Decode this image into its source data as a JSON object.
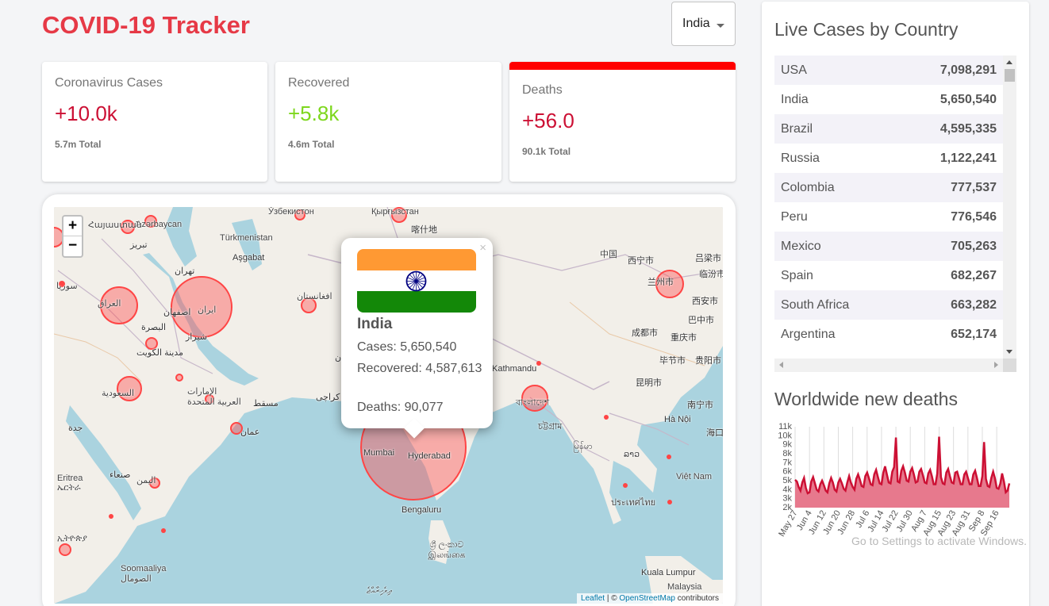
{
  "app": {
    "title": "COVID-19 Tracker"
  },
  "country_select": {
    "value": "India"
  },
  "stats": {
    "cases": {
      "label": "Coronavirus Cases",
      "value": "+10.0k",
      "total": "5.7m Total"
    },
    "recovered": {
      "label": "Recovered",
      "value": "+5.8k",
      "total": "4.6m Total"
    },
    "deaths": {
      "label": "Deaths",
      "value": "+56.0",
      "total": "90.1k Total"
    }
  },
  "colors": {
    "accent": "#e63946",
    "cases": "#cc1034",
    "recovered": "#7dd71d",
    "deaths_bar": "#ff0000",
    "circle": "#ff4545"
  },
  "map": {
    "zoom_in": "+",
    "zoom_out": "−",
    "attribution": {
      "leaflet": "Leaflet",
      "sep": " | © ",
      "osm": "OpenStreetMap",
      "suffix": " contributors"
    },
    "places": [
      "Türkmenistan",
      "Aşgabat",
      "Azərbaycan",
      "Հայաստան",
      "Ўзбекистон",
      "Қырғызстан",
      "喀什地",
      "中国",
      "西宁市",
      "兰州市",
      "吕梁市",
      "临汾市",
      "西安市",
      "巴中市",
      "成都市",
      "重庆市",
      "毕节市",
      "贵阳市",
      "昆明市",
      "南宁市",
      "Hà Nội",
      "海口",
      "Việt Nam",
      "ประเทศไทย",
      "ລາວ",
      "Malaysia",
      "Kuala Lumpur",
      "Mumbai",
      "Hyderabad",
      "Bengaluru",
      "ශ්‍රී ලංකාව இலங்கை",
      "ދިވެހިރާއްޖެ",
      "Soomaaliya الصومال",
      "Eritrea ኤርትራ",
      "ኢትዮጵያ",
      "اليمن",
      "صنعاء",
      "جدة",
      "مسقط",
      "عمان",
      "الإمارات العربية المتحدة",
      "السعودية",
      "العراق",
      "ایران",
      "اصفهان",
      "شیراز",
      "تهران",
      "تبريز",
      "مدينة الكويت",
      "البصرة",
      "افغانستان",
      "کراچی",
      "سوريا",
      "پاکستان",
      "Kathmandu",
      "বাংলাদেশ",
      "চট্টগ্রাম",
      "မြန်မာ"
    ],
    "popup": {
      "country": "India",
      "cases": "Cases: 5,650,540",
      "recovered": "Recovered: 4,587,613",
      "deaths": "Deaths: 90,077",
      "close": "×"
    }
  },
  "live_table": {
    "title": "Live Cases by Country",
    "rows": [
      {
        "country": "USA",
        "cases": "7,098,291"
      },
      {
        "country": "India",
        "cases": "5,650,540"
      },
      {
        "country": "Brazil",
        "cases": "4,595,335"
      },
      {
        "country": "Russia",
        "cases": "1,122,241"
      },
      {
        "country": "Colombia",
        "cases": "777,537"
      },
      {
        "country": "Peru",
        "cases": "776,546"
      },
      {
        "country": "Mexico",
        "cases": "705,263"
      },
      {
        "country": "Spain",
        "cases": "682,267"
      },
      {
        "country": "South Africa",
        "cases": "663,282"
      },
      {
        "country": "Argentina",
        "cases": "652,174"
      }
    ]
  },
  "chart_data": {
    "type": "area",
    "title": "Worldwide new deaths",
    "ylim": [
      2000,
      11000
    ],
    "y_ticks": [
      "11k",
      "10k",
      "9k",
      "8k",
      "7k",
      "6k",
      "5k",
      "4k",
      "3k",
      "2k"
    ],
    "x_ticks": [
      "May 27",
      "Jun 4",
      "Jun 12",
      "Jun 20",
      "Jun 28",
      "Jul 6",
      "Jul 14",
      "Jul 22",
      "Jul 30",
      "Aug 7",
      "Aug 15",
      "Aug 23",
      "Aug 31",
      "Sep 8",
      "Sep 16"
    ],
    "x_start": "May 27",
    "values": [
      5100,
      4900,
      4300,
      3900,
      4800,
      5300,
      4200,
      3600,
      3700,
      4900,
      5400,
      4700,
      4000,
      3800,
      4600,
      5000,
      4500,
      3900,
      3700,
      4700,
      5300,
      4800,
      4000,
      3800,
      4800,
      5200,
      4700,
      4100,
      3900,
      4800,
      5500,
      4800,
      4300,
      4000,
      5200,
      5700,
      5100,
      4400,
      4300,
      5500,
      5900,
      5300,
      4600,
      4500,
      5700,
      6200,
      5400,
      4700,
      4600,
      5900,
      6600,
      5700,
      4800,
      4700,
      6000,
      6500,
      9800,
      4900,
      4800,
      6100,
      6600,
      5900,
      5000,
      4900,
      6000,
      6400,
      5700,
      4800,
      4900,
      6000,
      6300,
      5600,
      4800,
      4700,
      5800,
      6200,
      5500,
      4600,
      4600,
      5800,
      9900,
      5400,
      4700,
      4600,
      5900,
      6300,
      5500,
      4800,
      4700,
      5900,
      6000,
      5300,
      4600,
      4600,
      5700,
      6000,
      5300,
      4600,
      4600,
      5700,
      6100,
      5300,
      4400,
      4400,
      5500,
      9300,
      5200,
      4400,
      4300,
      5300,
      6000,
      5300,
      4200,
      4100,
      4700,
      5800,
      4900,
      3700,
      3900,
      4700
    ],
    "colors": {
      "line": "#cc1034",
      "fill": "#e7798d"
    },
    "watermark": "Go to Settings to activate Windows."
  }
}
